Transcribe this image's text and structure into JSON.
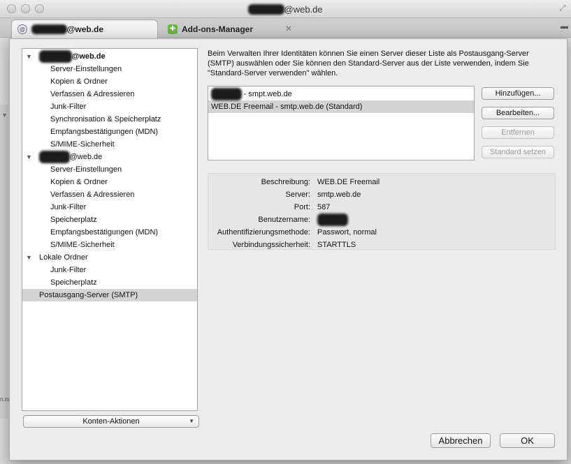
{
  "window": {
    "title_blurred": "ninjane9",
    "title_suffix": "@web.de",
    "fullscreen_glyph": "⤢"
  },
  "tabs": [
    {
      "label_blurred": "ninjane9",
      "label_suffix": "@web.de",
      "icon": "mail-icon",
      "icon_glyph": "@"
    },
    {
      "label": "Add-ons-Manager",
      "icon": "puzzle-icon",
      "icon_glyph": "✚",
      "close_glyph": "✕"
    }
  ],
  "tabstrip_menu_glyph": "▬",
  "tree": {
    "accounts": [
      {
        "name_blurred": "ninjane9",
        "name_suffix": "@web.de",
        "items": [
          "Server-Einstellungen",
          "Kopien & Ordner",
          "Verfassen & Adressieren",
          "Junk-Filter",
          "Synchronisation & Speicherplatz",
          "Empfangsbestätigungen (MDN)",
          "S/MIME-Sicherheit"
        ]
      },
      {
        "name_blurred": "ninjane9",
        "name_suffix": "@web.de",
        "items": [
          "Server-Einstellungen",
          "Kopien & Ordner",
          "Verfassen & Adressieren",
          "Junk-Filter",
          "Speicherplatz",
          "Empfangsbestätigungen (MDN)",
          "S/MIME-Sicherheit"
        ]
      },
      {
        "name": "Lokale Ordner",
        "items": [
          "Junk-Filter",
          "Speicherplatz"
        ]
      }
    ],
    "smtp_item": "Postausgang-Server (SMTP)",
    "twisty_glyph": "▼"
  },
  "account_actions": {
    "label": "Konten-Aktionen",
    "dropdown_glyph": "▼"
  },
  "description": "Beim Verwalten Ihrer Identitäten können Sie einen Server dieser Liste als Postausgang-Server (SMTP) auswählen oder Sie können den Standard-Server aus der Liste verwenden, indem Sie \"Standard-Server verwenden\" wählen.",
  "servers": [
    {
      "name_blurred": "ninjane9",
      "rest": " - smpt.web.de"
    },
    {
      "label": "WEB.DE Freemail - smtp.web.de (Standard)"
    }
  ],
  "buttons": {
    "add": "Hinzufügen...",
    "edit": "Bearbeiten...",
    "remove": "Entfernen",
    "set_default": "Standard setzen",
    "cancel": "Abbrechen",
    "ok": "OK"
  },
  "details": {
    "description_label": "Beschreibung:",
    "description_value": "WEB.DE Freemail",
    "server_label": "Server:",
    "server_value": "smtp.web.de",
    "port_label": "Port:",
    "port_value": "587",
    "username_label": "Benutzername:",
    "username_value_blurred": "ninjane9",
    "auth_label": "Authentifizierungsmethode:",
    "auth_value": "Passwort, normal",
    "security_label": "Verbindungssicherheit:",
    "security_value": "STARTTLS"
  },
  "peek": {
    "text": "n.m"
  }
}
